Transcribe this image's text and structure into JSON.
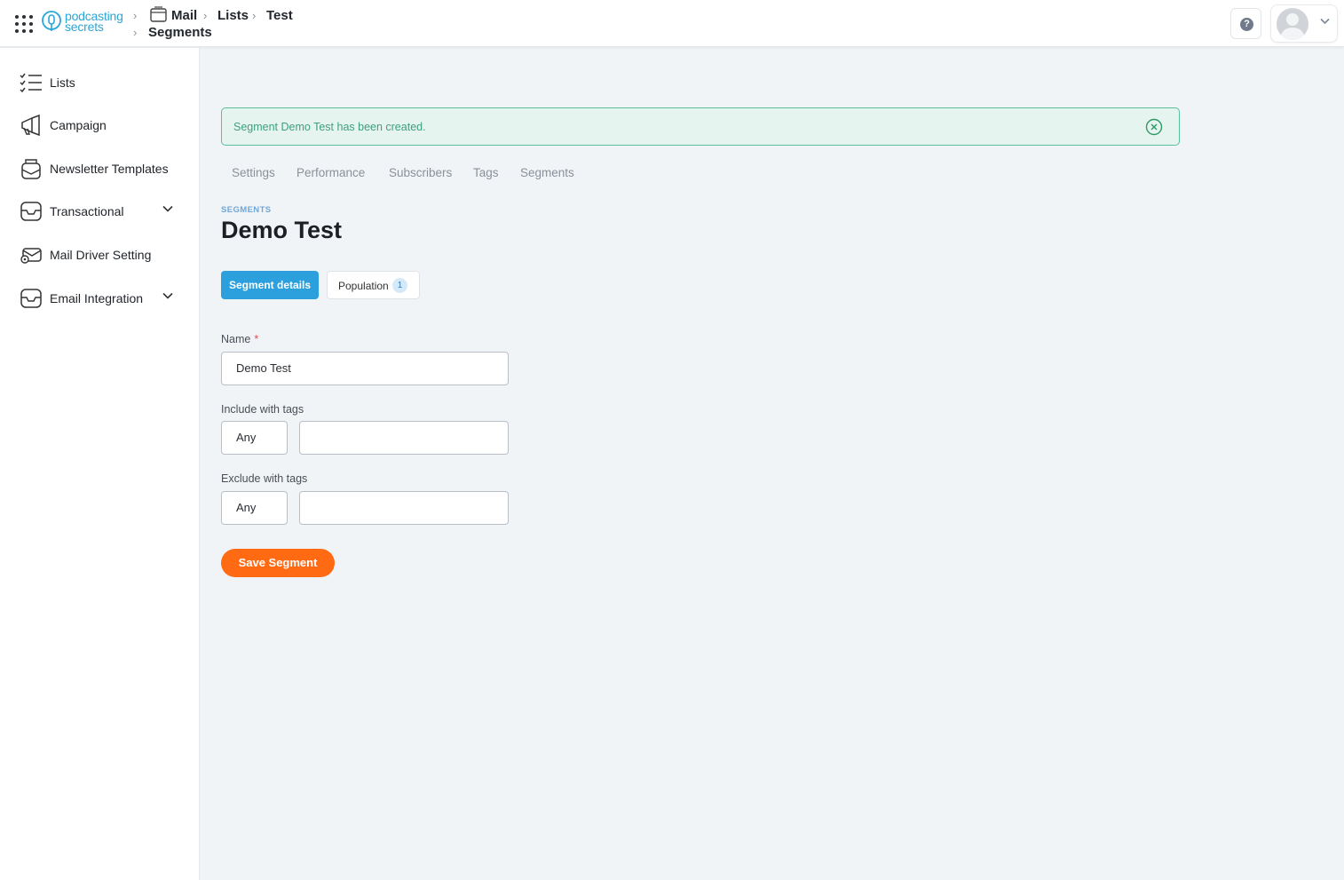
{
  "header": {
    "logo_line1": "podcasting",
    "logo_line2": "secrets",
    "breadcrumb": [
      "Mail",
      "Lists",
      "Test",
      "Segments"
    ]
  },
  "sidebar": {
    "items": [
      {
        "label": "Lists",
        "icon": "checklist-icon"
      },
      {
        "label": "Campaign",
        "icon": "megaphone-icon"
      },
      {
        "label": "Newsletter Templates",
        "icon": "newsletter-icon"
      },
      {
        "label": "Transactional",
        "icon": "inbox-icon",
        "expandable": true
      },
      {
        "label": "Mail Driver Setting",
        "icon": "mail-settings-icon"
      },
      {
        "label": "Email Integration",
        "icon": "inbox-icon",
        "expandable": true
      }
    ]
  },
  "alert": {
    "message": "Segment Demo Test has been created."
  },
  "tabs": [
    "Settings",
    "Performance",
    "Subscribers",
    "Tags",
    "Segments"
  ],
  "page": {
    "eyebrow": "SEGMENTS",
    "title": "Demo Test"
  },
  "segment_tabs": {
    "details_label": "Segment details",
    "population_label": "Population",
    "population_count": "1"
  },
  "form": {
    "name_label": "Name",
    "name_required_mark": "*",
    "name_value": "Demo Test",
    "include_label": "Include with tags",
    "include_mode": "Any",
    "include_tags": "",
    "exclude_label": "Exclude with tags",
    "exclude_mode": "Any",
    "exclude_tags": "",
    "save_label": "Save Segment"
  },
  "colors": {
    "accent_blue": "#2ba0dd",
    "save_orange": "#ff6a13",
    "alert_green": "#58c09a"
  }
}
